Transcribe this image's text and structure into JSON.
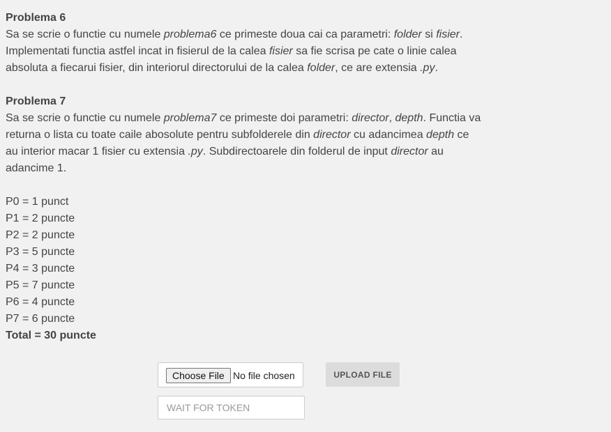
{
  "problema6": {
    "title": "Problema 6",
    "line1_a": "Sa se scrie o functie cu numele ",
    "line1_em1": "problema6",
    "line1_b": " ce primeste doua cai ca parametri: ",
    "line1_em2": "folder",
    "line1_c": " si ",
    "line1_em3": "fisier",
    "line1_d": ".",
    "line2_a": "Implementati functia astfel incat in fisierul de la calea ",
    "line2_em1": "fisier",
    "line2_b": " sa fie scrisa pe cate o linie calea",
    "line3_a": "absoluta a fiecarui fisier, din interiorul directorului de la calea ",
    "line3_em1": "folder",
    "line3_b": ", ce are extensia ",
    "line3_em2": ".py",
    "line3_c": "."
  },
  "problema7": {
    "title": "Problema 7",
    "line1_a": "Sa se scrie o functie cu numele ",
    "line1_em1": "problema7",
    "line1_b": " ce primeste doi parametri: ",
    "line1_em2": "director",
    "line1_c": ", ",
    "line1_em3": "depth",
    "line1_d": ". Functia va",
    "line2_a": "returna o lista cu toate caile abosolute pentru subfolderele din ",
    "line2_em1": "director",
    "line2_b": " cu adancimea ",
    "line2_em2": "depth",
    "line2_c": " ce",
    "line3_a": "au interior macar 1 fisier cu extensia ",
    "line3_em1": ".py",
    "line3_b": ". Subdirectoarele din folderul de input ",
    "line3_em2": "director",
    "line3_c": " au",
    "line4": "adancime 1."
  },
  "points": [
    "P0 = 1 punct",
    "P1 = 2 puncte",
    "P2 = 2 puncte",
    "P3 = 5 puncte",
    "P4 = 3 puncte",
    "P5 = 7 puncte",
    "P6 = 4 puncte",
    "P7 = 6 puncte"
  ],
  "total": "Total = 30 puncte",
  "form": {
    "choose_file_label": "Choose File",
    "no_file_text": "No file chosen",
    "upload_label": "UPLOAD FILE",
    "token_placeholder": "WAIT FOR TOKEN"
  }
}
